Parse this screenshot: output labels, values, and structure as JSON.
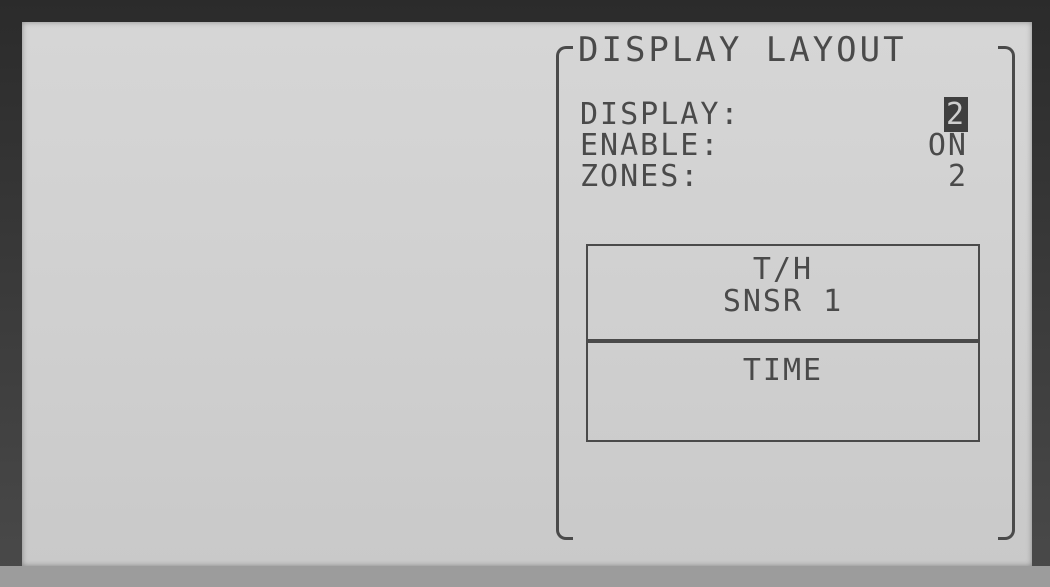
{
  "panel": {
    "title": "DISPLAY LAYOUT",
    "settings": [
      {
        "label": "DISPLAY:",
        "value": "2"
      },
      {
        "label": "ENABLE:",
        "value": "ON"
      },
      {
        "label": "ZONES:",
        "value": "2"
      }
    ],
    "zones": [
      {
        "line1": "T/H",
        "line2": "SNSR 1"
      },
      {
        "line1": "TIME"
      }
    ]
  }
}
